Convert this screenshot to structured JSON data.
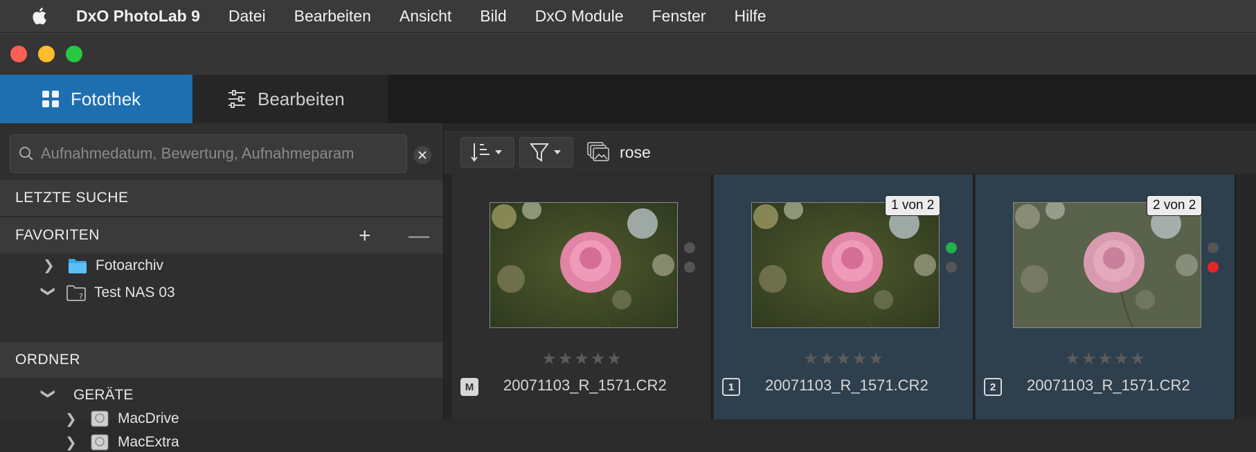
{
  "menubar": {
    "app_name": "DxO PhotoLab 9",
    "items": [
      "Datei",
      "Bearbeiten",
      "Ansicht",
      "Bild",
      "DxO Module",
      "Fenster",
      "Hilfe"
    ]
  },
  "tabs": {
    "library": "Fotothek",
    "customize": "Bearbeiten"
  },
  "sidebar": {
    "search_placeholder": "Aufnahmedatum, Bewertung, Aufnahmeparam",
    "recent_search": "LETZTE SUCHE",
    "favorites": {
      "title": "FAVORITEN",
      "add": "+",
      "remove": "—",
      "items": [
        {
          "label": "Fotoarchiv",
          "icon": "folder-blue-icon"
        },
        {
          "label": "Test NAS 03",
          "icon": "folder-missing-icon"
        }
      ]
    },
    "folders": {
      "title": "ORDNER",
      "devices_label": "GERÄTE",
      "drives": [
        "MacDrive",
        "MacExtra"
      ]
    }
  },
  "browser": {
    "project_name": "rose",
    "thumbnails": [
      {
        "filename": "20071103_R_1571.CR2",
        "version_icon": "M",
        "badge": "",
        "stars": "★★★★★",
        "dot_top": "#555555",
        "dot_bottom": "#555555"
      },
      {
        "filename": "20071103_R_1571.CR2",
        "version_icon": "1",
        "badge": "1 von 2",
        "stars": "★★★★★",
        "dot_top": "#22b14c",
        "dot_bottom": "#555555"
      },
      {
        "filename": "20071103_R_1571.CR2",
        "version_icon": "2",
        "badge": "2 von 2",
        "stars": "★★★★★",
        "dot_top": "#555555",
        "dot_bottom": "#e8262a"
      }
    ]
  },
  "colors": {
    "accent": "#1e6fb0",
    "selected_cell": "#2e3f4e"
  }
}
